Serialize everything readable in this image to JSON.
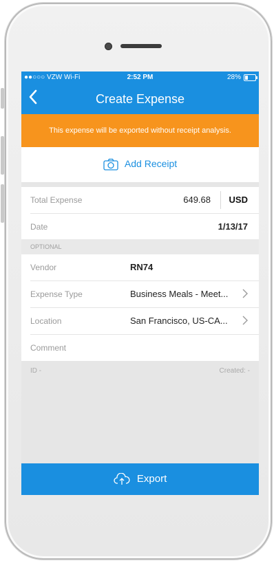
{
  "status": {
    "carrier": "●●○○○ VZW Wi-Fi",
    "time": "2:52 PM",
    "battery": "28%"
  },
  "nav": {
    "title": "Create Expense",
    "back_icon": "chevron-left-icon"
  },
  "banner": {
    "text": "This expense will be exported without receipt analysis."
  },
  "receipt": {
    "label": "Add Receipt",
    "icon": "camera-icon"
  },
  "expense": {
    "total_label": "Total Expense",
    "total_value": "649.68",
    "currency": "USD",
    "date_label": "Date",
    "date_value": "1/13/17"
  },
  "optional": {
    "header": "OPTIONAL",
    "vendor_label": "Vendor",
    "vendor_value": "RN74",
    "type_label": "Expense Type",
    "type_value": "Business Meals - Meet...",
    "location_label": "Location",
    "location_value": "San Francisco, US-CA...",
    "comment_label": "Comment"
  },
  "meta": {
    "id": "ID -",
    "created": "Created: -"
  },
  "footer": {
    "export_label": "Export",
    "icon": "cloud-upload-icon"
  },
  "colors": {
    "primary": "#1a8fe0",
    "banner": "#f7941d"
  }
}
